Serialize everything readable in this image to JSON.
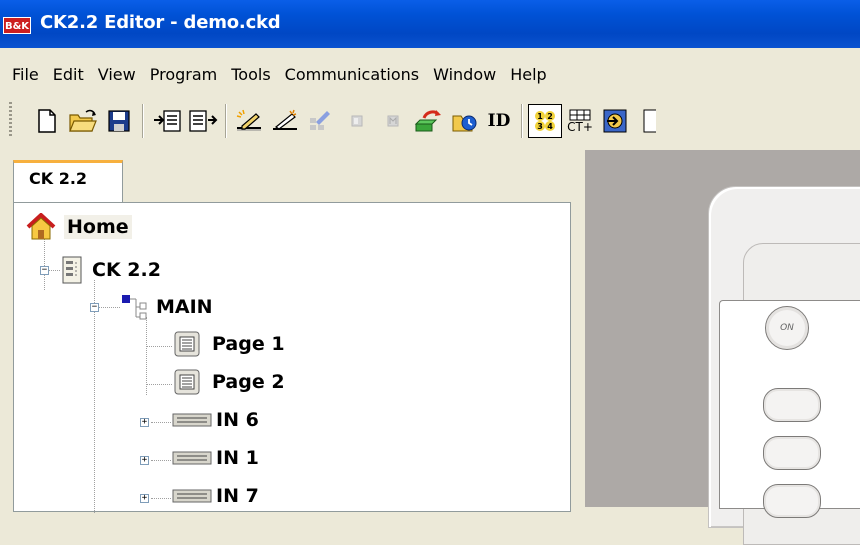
{
  "window": {
    "title": "CK2.2 Editor - demo.ckd",
    "app_icon_label": "B&K"
  },
  "menu": [
    "File",
    "Edit",
    "View",
    "Program",
    "Tools",
    "Communications",
    "Window",
    "Help"
  ],
  "toolbar": {
    "id_label": "ID",
    "ct_label": "CT+"
  },
  "panel": {
    "tab_label": "CK 2.2",
    "tree": {
      "home": "Home",
      "root": "CK 2.2",
      "main": "MAIN",
      "pages": [
        "Page 1",
        "Page 2"
      ],
      "inputs": [
        "IN 6",
        "IN 1",
        "IN 7"
      ]
    }
  },
  "device": {
    "on_label": "ON"
  },
  "colors": {
    "titlebar": "#0052d6",
    "tab_accent": "#f7b03e",
    "workspace": "#ada9a6",
    "app_icon": "#cc1f1f"
  }
}
